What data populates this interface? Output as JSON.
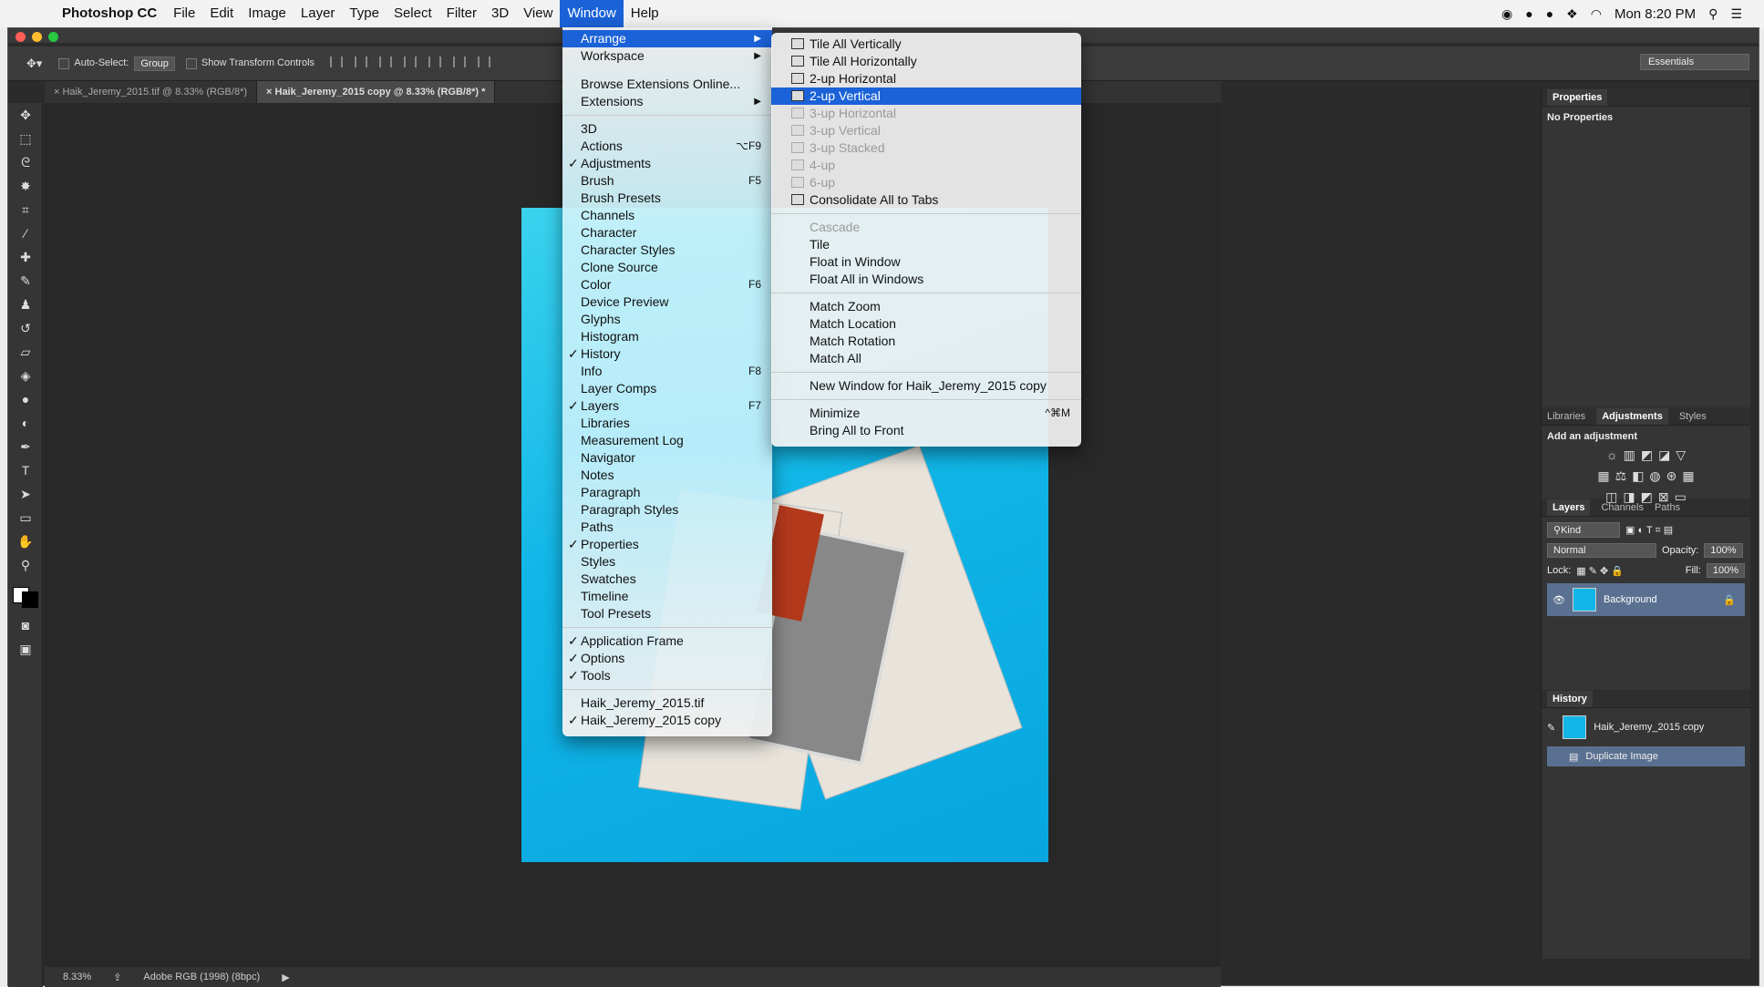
{
  "menubar": {
    "app": "Photoshop CC",
    "items": [
      "File",
      "Edit",
      "Image",
      "Layer",
      "Type",
      "Select",
      "Filter",
      "3D",
      "View",
      "Window",
      "Help"
    ],
    "active": "Window",
    "clock": "Mon 8:20 PM"
  },
  "options_bar": {
    "auto_select_label": "Auto-Select:",
    "auto_select_value": "Group",
    "transform_label": "Show Transform Controls",
    "workspace": "Essentials"
  },
  "tabs": [
    {
      "label": "Haik_Jeremy_2015.tif @ 8.33% (RGB/8*)",
      "active": false
    },
    {
      "label": "Haik_Jeremy_2015 copy @ 8.33% (RGB/8*) *",
      "active": true
    }
  ],
  "status": {
    "zoom": "8.33%",
    "profile": "Adobe RGB (1998) (8bpc)"
  },
  "panels": {
    "properties": {
      "title": "Properties",
      "body": "No Properties"
    },
    "adjust_tabs": [
      "Libraries",
      "Adjustments",
      "Styles"
    ],
    "adjust_hint": "Add an adjustment",
    "layer_tabs": [
      "Layers",
      "Channels",
      "Paths"
    ],
    "kind": "Kind",
    "blend": "Normal",
    "opacity_label": "Opacity:",
    "opacity": "100%",
    "lock_label": "Lock:",
    "fill_label": "Fill:",
    "fill": "100%",
    "layer_name": "Background",
    "history_title": "History",
    "history_items": [
      "Haik_Jeremy_2015 copy",
      "Duplicate Image"
    ]
  },
  "window_menu": {
    "group1": [
      {
        "label": "Arrange",
        "arrow": "▶",
        "hl": true
      },
      {
        "label": "Workspace",
        "arrow": "▶"
      }
    ],
    "group2": [
      {
        "label": "Browse Extensions Online..."
      },
      {
        "label": "Extensions",
        "arrow": "▶"
      }
    ],
    "group3": [
      {
        "label": "3D"
      },
      {
        "label": "Actions",
        "sc": "⌥F9"
      },
      {
        "label": "Adjustments",
        "chk": "✓"
      },
      {
        "label": "Brush",
        "sc": "F5"
      },
      {
        "label": "Brush Presets"
      },
      {
        "label": "Channels"
      },
      {
        "label": "Character"
      },
      {
        "label": "Character Styles"
      },
      {
        "label": "Clone Source"
      },
      {
        "label": "Color",
        "sc": "F6"
      },
      {
        "label": "Device Preview"
      },
      {
        "label": "Glyphs"
      },
      {
        "label": "Histogram"
      },
      {
        "label": "History",
        "chk": "✓"
      },
      {
        "label": "Info",
        "sc": "F8"
      },
      {
        "label": "Layer Comps"
      },
      {
        "label": "Layers",
        "chk": "✓",
        "sc": "F7"
      },
      {
        "label": "Libraries"
      },
      {
        "label": "Measurement Log"
      },
      {
        "label": "Navigator"
      },
      {
        "label": "Notes"
      },
      {
        "label": "Paragraph"
      },
      {
        "label": "Paragraph Styles"
      },
      {
        "label": "Paths"
      },
      {
        "label": "Properties",
        "chk": "✓"
      },
      {
        "label": "Styles"
      },
      {
        "label": "Swatches"
      },
      {
        "label": "Timeline"
      },
      {
        "label": "Tool Presets"
      }
    ],
    "group4": [
      {
        "label": "Application Frame",
        "chk": "✓"
      },
      {
        "label": "Options",
        "chk": "✓"
      },
      {
        "label": "Tools",
        "chk": "✓"
      }
    ],
    "group5": [
      {
        "label": "Haik_Jeremy_2015.tif"
      },
      {
        "label": "Haik_Jeremy_2015 copy",
        "chk": "✓"
      }
    ]
  },
  "arrange_menu": {
    "group1": [
      {
        "label": "Tile All Vertically"
      },
      {
        "label": "Tile All Horizontally"
      },
      {
        "label": "2-up Horizontal"
      },
      {
        "label": "2-up Vertical",
        "hl": true
      },
      {
        "label": "3-up Horizontal",
        "dis": true
      },
      {
        "label": "3-up Vertical",
        "dis": true
      },
      {
        "label": "3-up Stacked",
        "dis": true
      },
      {
        "label": "4-up",
        "dis": true
      },
      {
        "label": "6-up",
        "dis": true
      },
      {
        "label": "Consolidate All to Tabs"
      }
    ],
    "group2": [
      {
        "label": "Cascade",
        "dis": true
      },
      {
        "label": "Tile"
      },
      {
        "label": "Float in Window"
      },
      {
        "label": "Float All in Windows"
      }
    ],
    "group3": [
      {
        "label": "Match Zoom"
      },
      {
        "label": "Match Location"
      },
      {
        "label": "Match Rotation"
      },
      {
        "label": "Match All"
      }
    ],
    "group4": [
      {
        "label": "New Window for Haik_Jeremy_2015 copy"
      }
    ],
    "group5": [
      {
        "label": "Minimize",
        "sc": "^⌘M"
      },
      {
        "label": "Bring All to Front"
      }
    ]
  }
}
